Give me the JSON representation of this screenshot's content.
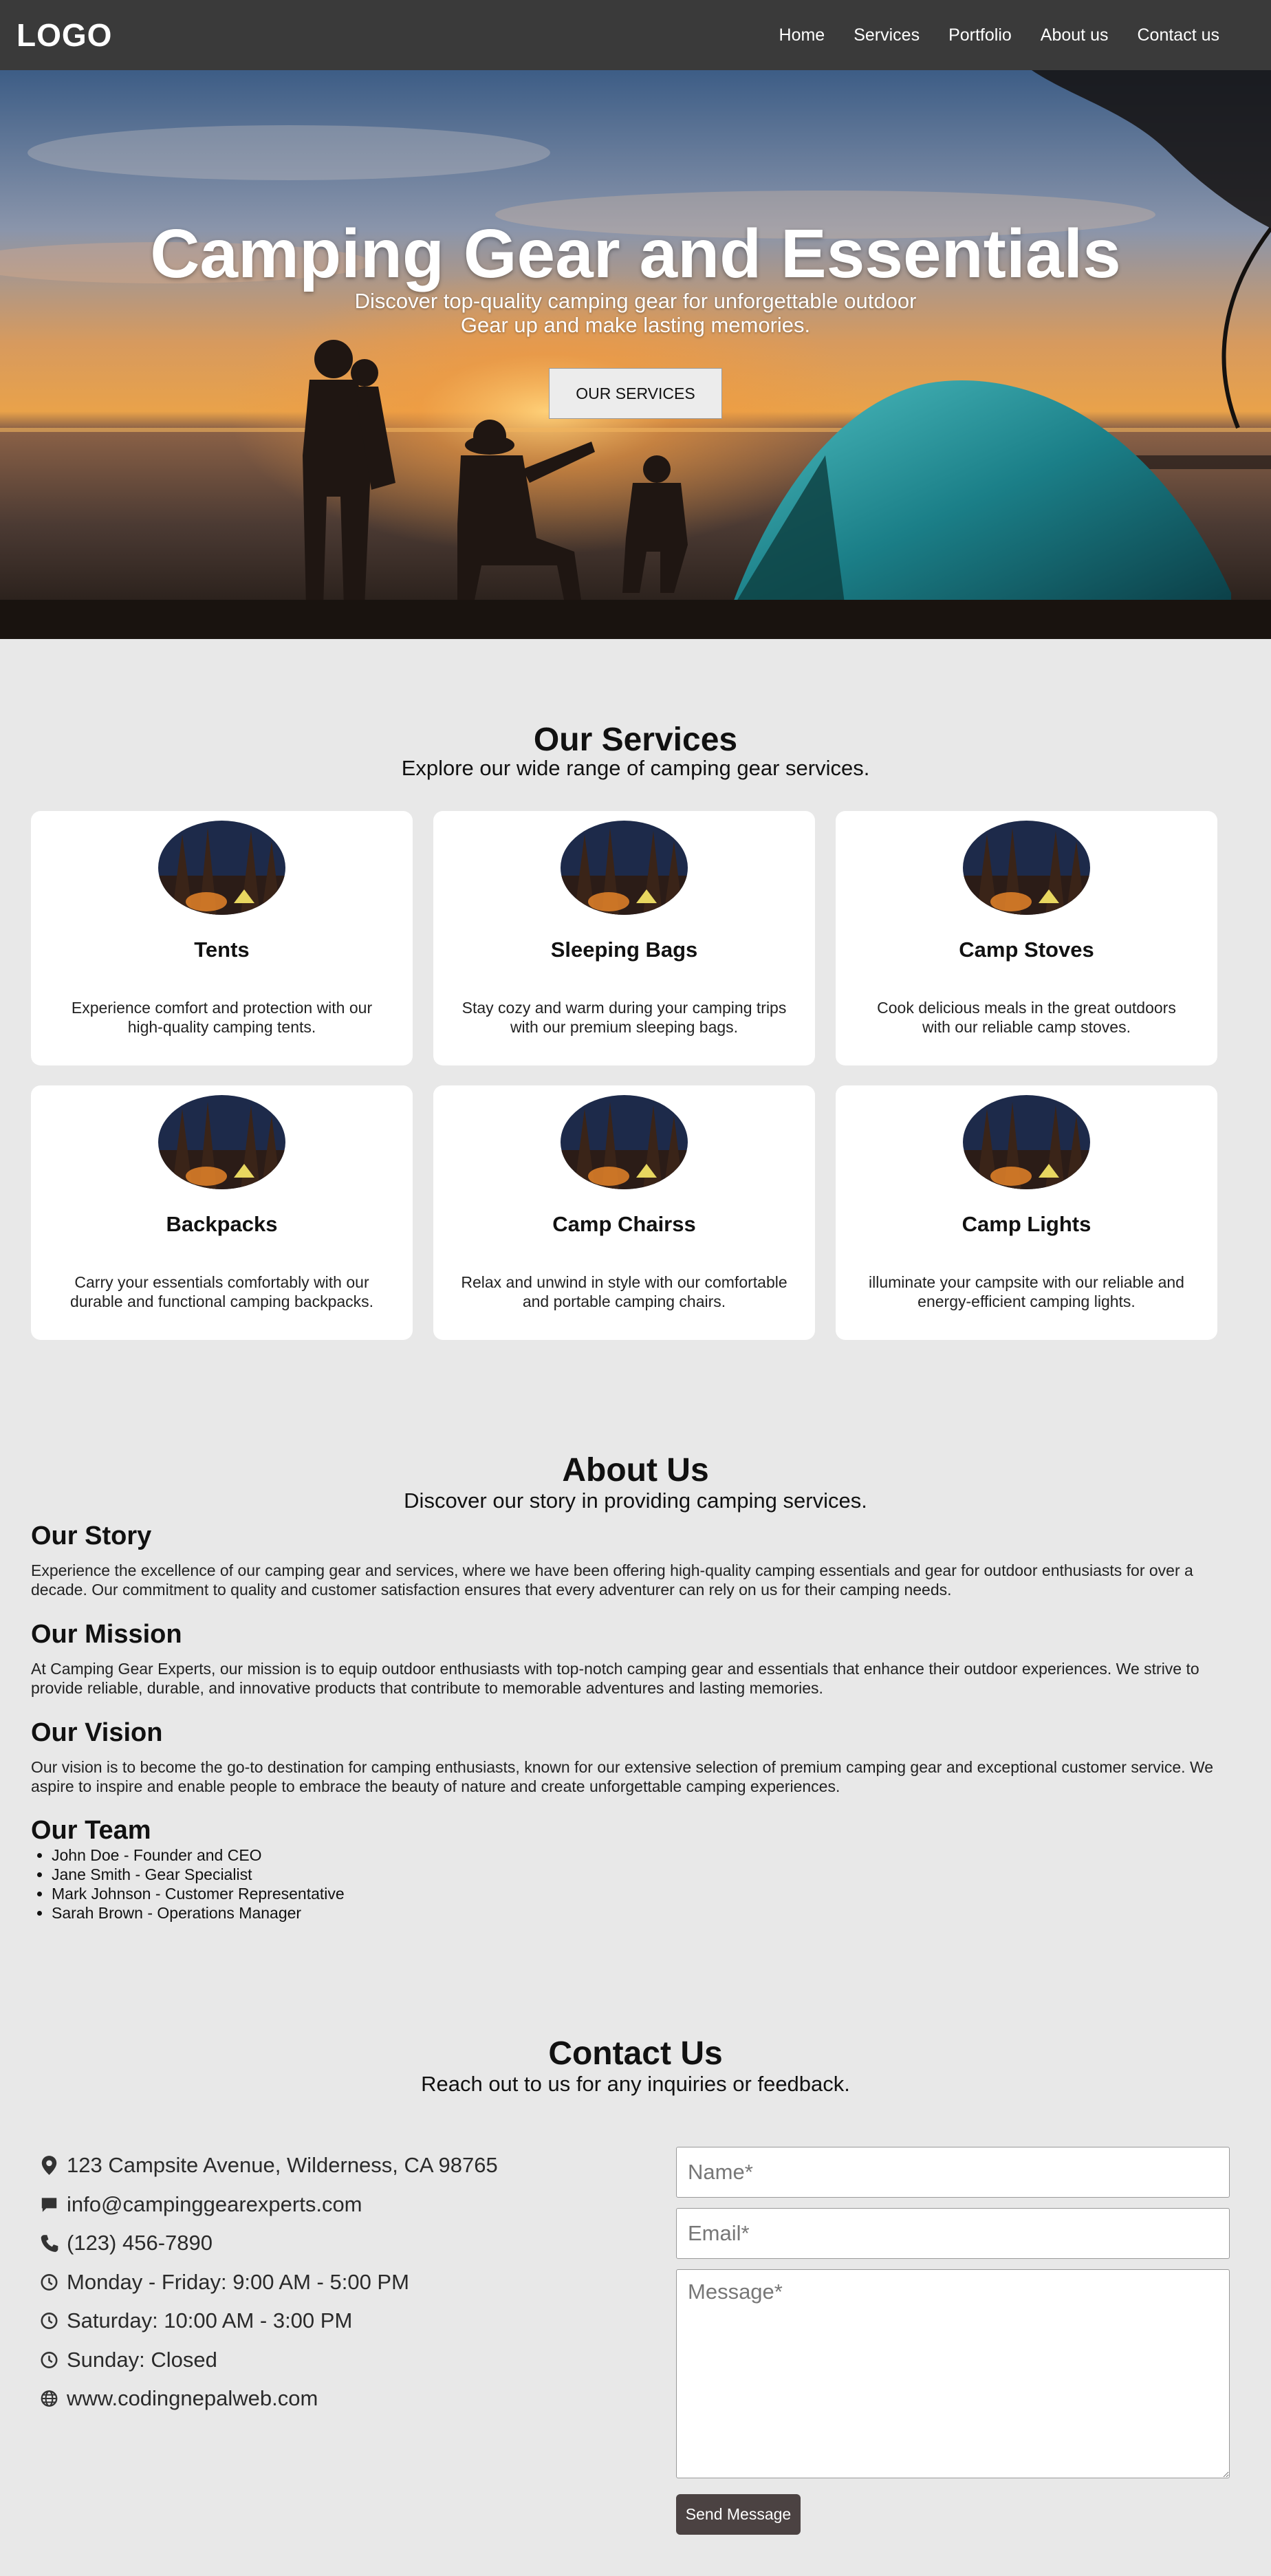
{
  "nav": {
    "logo": "LOGO",
    "links": [
      "Home",
      "Services",
      "Portfolio",
      "About us",
      "Contact us"
    ]
  },
  "hero": {
    "title": "Camping Gear and Essentials",
    "subtitle_line1": "Discover top-quality camping gear for unforgettable outdoor",
    "subtitle_line2": "Gear up and make lasting memories.",
    "button_label": "OUR SERVICES"
  },
  "services": {
    "title": "Our Services",
    "subtitle": "Explore our wide range of camping gear services.",
    "cards": [
      {
        "title": "Tents",
        "desc": "Experience comfort and protection with our high-quality camping tents."
      },
      {
        "title": "Sleeping Bags",
        "desc": "Stay cozy and warm during your camping trips with our premium sleeping bags."
      },
      {
        "title": "Camp Stoves",
        "desc": "Cook delicious meals in the great outdoors with our reliable camp stoves."
      },
      {
        "title": "Backpacks",
        "desc": "Carry your essentials comfortably with our durable and functional camping backpacks."
      },
      {
        "title": "Camp Chairss",
        "desc": "Relax and unwind in style with our comfortable and portable camping chairs."
      },
      {
        "title": "Camp Lights",
        "desc": "illuminate your campsite with our reliable and energy-efficient camping lights."
      }
    ]
  },
  "about": {
    "title": "About Us",
    "subtitle": "Discover our story in providing camping services.",
    "story_title": "Our Story",
    "story_text": "Experience the excellence of our camping gear and services, where we have been offering high-quality camping essentials and gear for outdoor enthusiasts for over a decade. Our commitment to quality and customer satisfaction ensures that every adventurer can rely on us for their camping needs.",
    "mission_title": "Our Mission",
    "mission_text": "At Camping Gear Experts, our mission is to equip outdoor enthusiasts with top-notch camping gear and essentials that enhance their outdoor experiences. We strive to provide reliable, durable, and innovative products that contribute to memorable adventures and lasting memories.",
    "vision_title": "Our Vision",
    "vision_text": "Our vision is to become the go-to destination for camping enthusiasts, known for our extensive selection of premium camping gear and exceptional customer service. We aspire to inspire and enable people to embrace the beauty of nature and create unforgettable camping experiences.",
    "team_title": "Our Team",
    "team": [
      "John Doe - Founder and CEO",
      "Jane Smith - Gear Specialist",
      "Mark Johnson - Customer Representative",
      "Sarah Brown - Operations Manager"
    ]
  },
  "contact": {
    "title": "Contact Us",
    "subtitle": "Reach out to us for any inquiries or feedback.",
    "info": [
      {
        "icon": "location-pin-icon",
        "text": "123 Campsite Avenue, Wilderness, CA 98765"
      },
      {
        "icon": "chat-bubble-icon",
        "text": "info@campinggearexperts.com"
      },
      {
        "icon": "phone-icon",
        "text": "(123) 456-7890"
      },
      {
        "icon": "clock-icon",
        "text": "Monday - Friday: 9:00 AM - 5:00 PM"
      },
      {
        "icon": "clock-icon",
        "text": "Saturday: 10:00 AM - 3:00 PM"
      },
      {
        "icon": "clock-icon",
        "text": "Sunday: Closed"
      },
      {
        "icon": "globe-icon",
        "text": "www.codingnepalweb.com"
      }
    ],
    "form": {
      "name_placeholder": "Name*",
      "email_placeholder": "Email*",
      "message_placeholder": "Message*",
      "send_label": "Send Message"
    }
  },
  "colors": {
    "navbar": "#3a3a3a",
    "page_bg": "#e8e8e8",
    "card_bg": "#ffffff",
    "send_button": "#4b4242"
  }
}
